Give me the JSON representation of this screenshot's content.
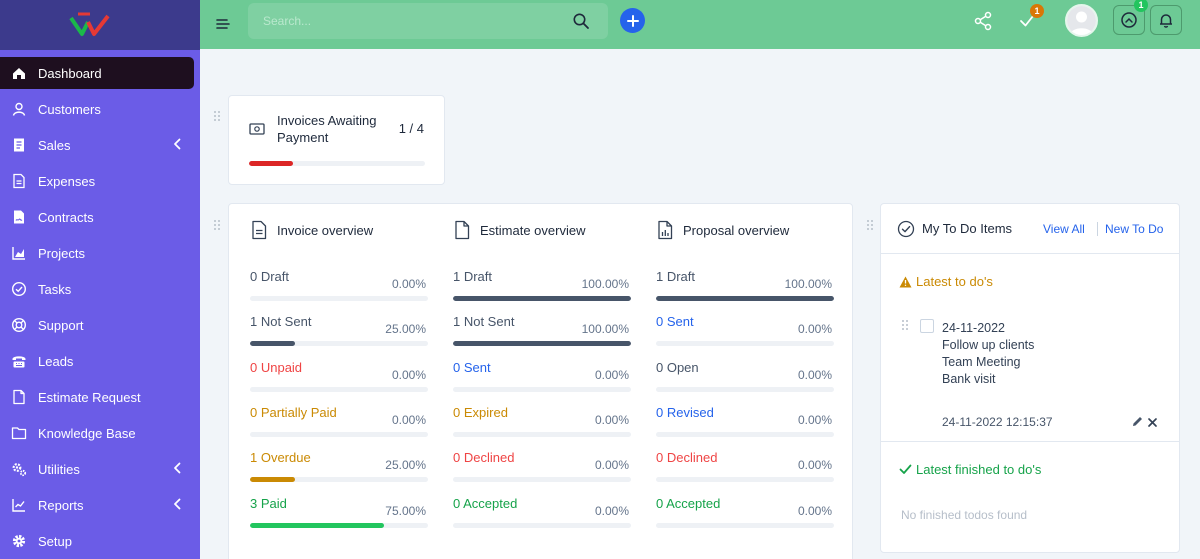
{
  "search": {
    "placeholder": "Search..."
  },
  "topbar": {
    "tasks_badge": "1",
    "notifications_badge": "1"
  },
  "sidebar": {
    "items": [
      {
        "label": "Dashboard",
        "icon": "home-icon",
        "active": true,
        "has_submenu": false
      },
      {
        "label": "Customers",
        "icon": "user-icon",
        "active": false,
        "has_submenu": false
      },
      {
        "label": "Sales",
        "icon": "receipt-icon",
        "active": false,
        "has_submenu": true
      },
      {
        "label": "Expenses",
        "icon": "file-lines-icon",
        "active": false,
        "has_submenu": false
      },
      {
        "label": "Contracts",
        "icon": "file-contract-icon",
        "active": false,
        "has_submenu": false
      },
      {
        "label": "Projects",
        "icon": "chart-area-icon",
        "active": false,
        "has_submenu": false
      },
      {
        "label": "Tasks",
        "icon": "check-circle-icon",
        "active": false,
        "has_submenu": false
      },
      {
        "label": "Support",
        "icon": "life-ring-icon",
        "active": false,
        "has_submenu": false
      },
      {
        "label": "Leads",
        "icon": "tty-icon",
        "active": false,
        "has_submenu": false
      },
      {
        "label": "Estimate Request",
        "icon": "file-icon",
        "active": false,
        "has_submenu": false
      },
      {
        "label": "Knowledge Base",
        "icon": "folder-icon",
        "active": false,
        "has_submenu": false
      },
      {
        "label": "Utilities",
        "icon": "cogs-icon",
        "active": false,
        "has_submenu": true
      },
      {
        "label": "Reports",
        "icon": "chart-line-icon",
        "active": false,
        "has_submenu": true
      },
      {
        "label": "Setup",
        "icon": "gear-icon",
        "active": false,
        "has_submenu": false
      }
    ]
  },
  "invoices_awaiting": {
    "title": "Invoices Awaiting Payment",
    "count": "1 / 4",
    "progress": 0.25,
    "color": "#dc2626"
  },
  "overview": {
    "invoice": {
      "title": "Invoice overview",
      "rows": [
        {
          "label": "0 Draft",
          "pct": "0.00%",
          "value": 0,
          "tone": "c-dark",
          "fill": "#475569"
        },
        {
          "label": "1 Not Sent",
          "pct": "25.00%",
          "value": 25,
          "tone": "c-dark",
          "fill": "#475569"
        },
        {
          "label": "0 Unpaid",
          "pct": "0.00%",
          "value": 0,
          "tone": "c-red",
          "fill": "#ef4444"
        },
        {
          "label": "0 Partially Paid",
          "pct": "0.00%",
          "value": 0,
          "tone": "c-orange",
          "fill": "#ca8a04"
        },
        {
          "label": "1 Overdue",
          "pct": "25.00%",
          "value": 25,
          "tone": "c-orange",
          "fill": "#ca8a04"
        },
        {
          "label": "3 Paid",
          "pct": "75.00%",
          "value": 75,
          "tone": "c-green",
          "fill": "#22c55e"
        }
      ]
    },
    "estimate": {
      "title": "Estimate overview",
      "rows": [
        {
          "label": "1 Draft",
          "pct": "100.00%",
          "value": 100,
          "tone": "c-dark",
          "fill": "#475569"
        },
        {
          "label": "1 Not Sent",
          "pct": "100.00%",
          "value": 100,
          "tone": "c-dark",
          "fill": "#475569"
        },
        {
          "label": "0 Sent",
          "pct": "0.00%",
          "value": 0,
          "tone": "c-blue",
          "fill": "#2563eb"
        },
        {
          "label": "0 Expired",
          "pct": "0.00%",
          "value": 0,
          "tone": "c-orange",
          "fill": "#ca8a04"
        },
        {
          "label": "0 Declined",
          "pct": "0.00%",
          "value": 0,
          "tone": "c-red",
          "fill": "#ef4444"
        },
        {
          "label": "0 Accepted",
          "pct": "0.00%",
          "value": 0,
          "tone": "c-green",
          "fill": "#22c55e"
        }
      ]
    },
    "proposal": {
      "title": "Proposal overview",
      "rows": [
        {
          "label": "1 Draft",
          "pct": "100.00%",
          "value": 100,
          "tone": "c-dark",
          "fill": "#475569"
        },
        {
          "label": "0 Sent",
          "pct": "0.00%",
          "value": 0,
          "tone": "c-blue",
          "fill": "#2563eb"
        },
        {
          "label": "0 Open",
          "pct": "0.00%",
          "value": 0,
          "tone": "c-dark",
          "fill": "#475569"
        },
        {
          "label": "0 Revised",
          "pct": "0.00%",
          "value": 0,
          "tone": "c-blue",
          "fill": "#2563eb"
        },
        {
          "label": "0 Declined",
          "pct": "0.00%",
          "value": 0,
          "tone": "c-red",
          "fill": "#ef4444"
        },
        {
          "label": "0 Accepted",
          "pct": "0.00%",
          "value": 0,
          "tone": "c-green",
          "fill": "#22c55e"
        }
      ]
    }
  },
  "todo": {
    "title": "My To Do Items",
    "view_all": "View All",
    "new_todo": "New To Do",
    "latest_label": "Latest to do's",
    "item": {
      "date": "24-11-2022",
      "lines": [
        "Follow up clients",
        "Team Meeting",
        "Bank visit"
      ],
      "timestamp": "24-11-2022 12:15:37"
    },
    "finished_label": "Latest finished to do's",
    "finished_empty": "No finished todos found"
  }
}
